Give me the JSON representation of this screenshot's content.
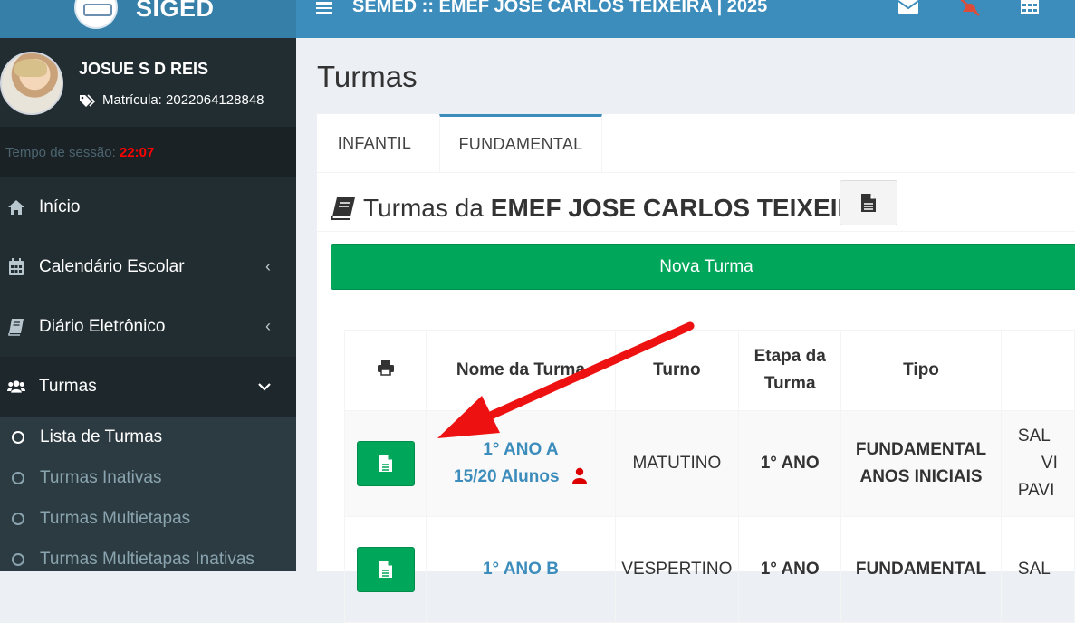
{
  "app": {
    "logo_text": "SIGED",
    "header_title": "SEMED :: EMEF JOSE CARLOS TEIXEIRA | 2025"
  },
  "colors": {
    "sidebar": "#222d32",
    "header": "#3c8dbc",
    "success": "#00a65a",
    "link": "#3c8dbc",
    "danger": "#dd4b39",
    "arrow": "#ee1111"
  },
  "user": {
    "name": "JOSUE S D REIS",
    "matricula": "Matrícula: 2022064128848"
  },
  "session": {
    "label": "Tempo de sessão:",
    "time": "22:07"
  },
  "menu": [
    {
      "label": "Início",
      "icon": "home-icon"
    },
    {
      "label": "Calendário Escolar",
      "icon": "calendar-icon"
    },
    {
      "label": "Diário Eletrônico",
      "icon": "book-icon"
    },
    {
      "label": "Turmas",
      "icon": "users-icon"
    }
  ],
  "submenu": [
    {
      "label": "Lista de Turmas"
    },
    {
      "label": "Turmas Inativas"
    },
    {
      "label": "Turmas Multietapas"
    },
    {
      "label": "Turmas Multietapas Inativas"
    }
  ],
  "page": {
    "title": "Turmas"
  },
  "tabs": [
    {
      "label": "INFANTIL"
    },
    {
      "label": "FUNDAMENTAL"
    }
  ],
  "box": {
    "title_prefix": "Turmas da",
    "title_school": "EMEF JOSE CARLOS TEIXEIRA",
    "new_button": "Nova Turma"
  },
  "table": {
    "headers": {
      "name": "Nome da Turma",
      "turno": "Turno",
      "etapa_line1": "Etapa da",
      "etapa_line2": "Turma",
      "tipo": "Tipo"
    },
    "rows": [
      {
        "name": "1° ANO A",
        "alunos": "15/20 Alunos",
        "turno": "MATUTINO",
        "etapa": "1° ANO",
        "tipo_line1": "FUNDAMENTAL",
        "tipo_line2": "ANOS INICIAIS",
        "sala_line1": "SAL",
        "sala_line2": "VI",
        "sala_line3": "PAVI"
      },
      {
        "name": "1° ANO B",
        "turno": "VESPERTINO",
        "etapa": "1° ANO",
        "tipo_line1": "FUNDAMENTAL",
        "sala_line1": "SAL"
      }
    ]
  }
}
